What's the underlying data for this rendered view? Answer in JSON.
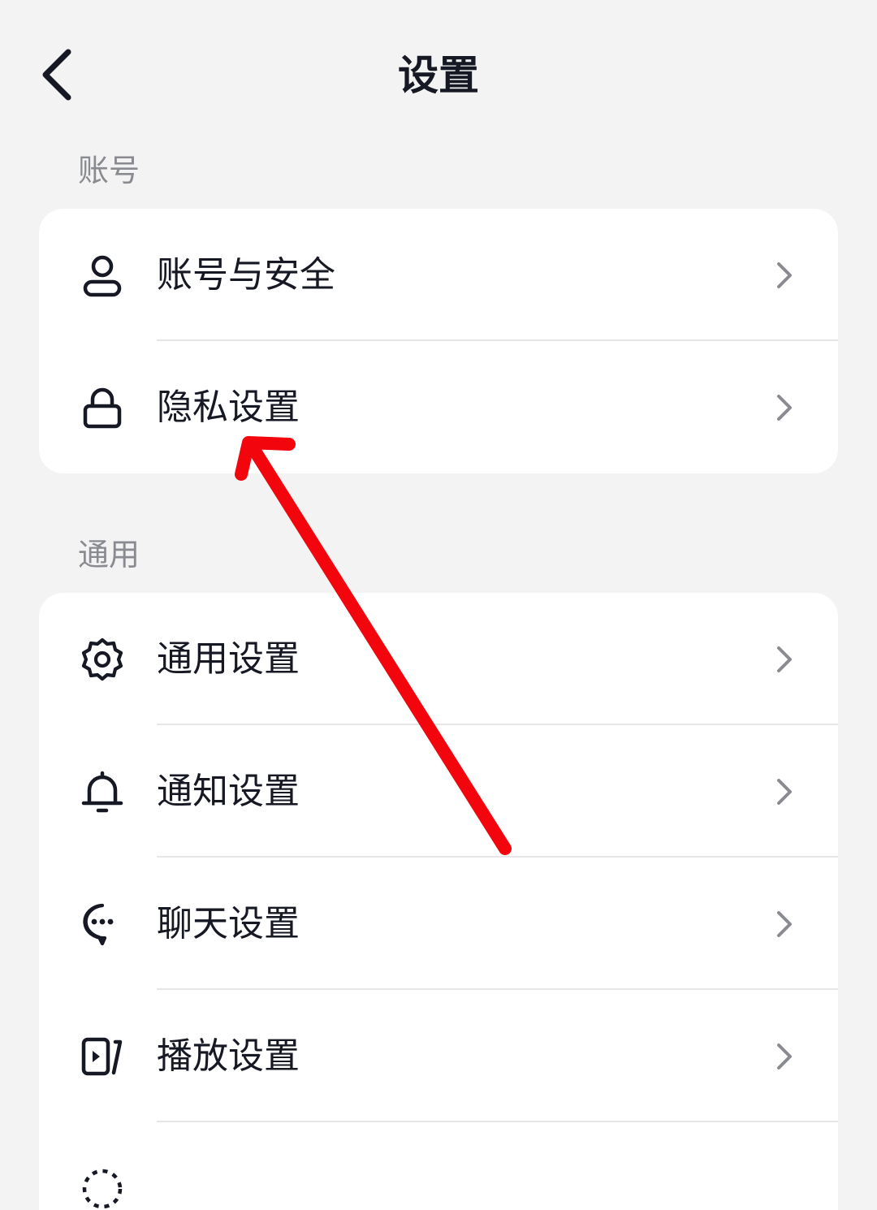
{
  "header": {
    "title": "设置",
    "back_icon": "chevron-left-icon"
  },
  "sections": [
    {
      "title": "账号",
      "items": [
        {
          "label": "账号与安全",
          "icon": "user-icon"
        },
        {
          "label": "隐私设置",
          "icon": "lock-icon"
        }
      ]
    },
    {
      "title": "通用",
      "items": [
        {
          "label": "通用设置",
          "icon": "gear-icon"
        },
        {
          "label": "通知设置",
          "icon": "bell-icon"
        },
        {
          "label": "聊天设置",
          "icon": "chat-bubble-icon"
        },
        {
          "label": "播放设置",
          "icon": "play-settings-icon"
        },
        {
          "label": "",
          "icon": "loading-icon"
        }
      ]
    }
  ],
  "annotation": {
    "type": "arrow",
    "color": "#f2050c",
    "points_to": "隐私设置"
  },
  "colors": {
    "background": "#f3f3f3",
    "card": "#ffffff",
    "text": "#161823",
    "section_label": "#8a8b91",
    "chevron": "#8a8b91",
    "divider": "#e6e6e8"
  }
}
